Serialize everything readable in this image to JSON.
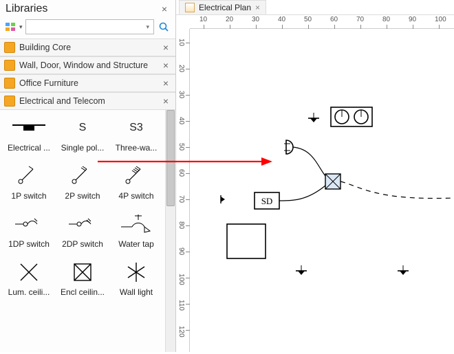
{
  "sidebar": {
    "title": "Libraries",
    "search_placeholder": "",
    "groups": [
      {
        "label": "Building Core"
      },
      {
        "label": "Wall, Door, Window and Structure"
      },
      {
        "label": "Office Furniture"
      },
      {
        "label": "Electrical and Telecom"
      }
    ],
    "shapes": [
      {
        "label": "Electrical ..."
      },
      {
        "label": "Single pol..."
      },
      {
        "label": "Three-wa..."
      },
      {
        "label": "1P switch"
      },
      {
        "label": "2P switch"
      },
      {
        "label": "4P switch"
      },
      {
        "label": "1DP switch"
      },
      {
        "label": "2DP switch"
      },
      {
        "label": "Water tap"
      },
      {
        "label": "Lum. ceili..."
      },
      {
        "label": "Encl ceilin..."
      },
      {
        "label": "Wall light"
      }
    ],
    "shape_text": {
      "s": "S",
      "s3": "S3",
      "sd": "SD"
    }
  },
  "tab": {
    "title": "Electrical Plan"
  },
  "ruler": {
    "h": [
      10,
      20,
      30,
      40,
      50,
      60,
      70,
      80,
      90,
      100
    ],
    "v": [
      10,
      20,
      30,
      40,
      50,
      60,
      70,
      80,
      90,
      100,
      110,
      120
    ]
  },
  "canvas_label": "SD"
}
